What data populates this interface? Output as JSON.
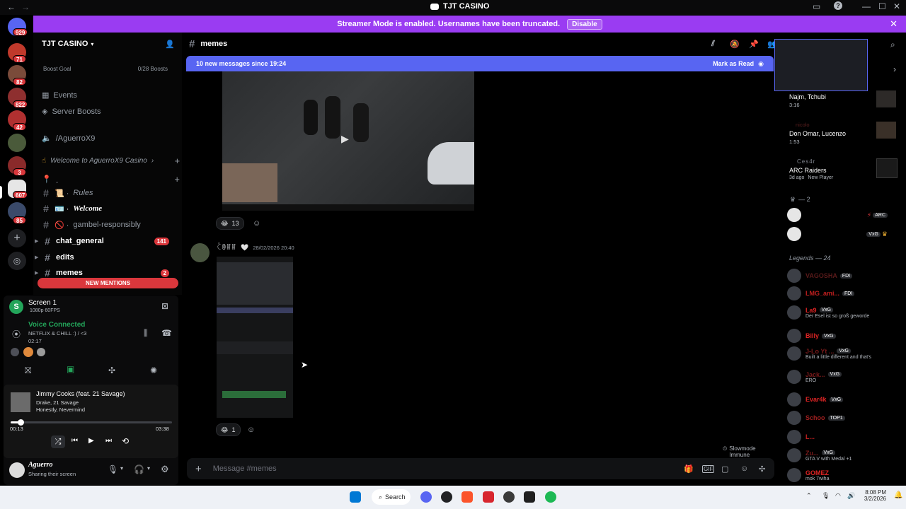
{
  "titlebar": {
    "back": "←",
    "forward": "→",
    "title": "TJT CASINO"
  },
  "banner": {
    "text": "Streamer Mode is enabled. Usernames have been truncated.",
    "disable": "Disable"
  },
  "rail": {
    "badges": [
      "929",
      "71",
      "82",
      "822",
      "42",
      "3",
      "607",
      "85"
    ]
  },
  "sidebar": {
    "server_name": "TJT CASINO",
    "boost_goal": "Boost Goal",
    "boost_count": "0/28 Boosts",
    "events": "Events",
    "server_boosts": "Server Boosts",
    "aguerro_channel": "/AguerroX9",
    "welcome_category": "Welcome to AguerroX9 Casino",
    "empty_category": "˯",
    "channels": [
      {
        "label": "Rules",
        "prefix": "📜 ·"
      },
      {
        "label": "Welcome",
        "prefix": "🪪 ·"
      },
      {
        "label": "gambel-responsibly",
        "prefix": "🚫 ·"
      },
      {
        "label": "chat_general",
        "count": "141"
      },
      {
        "label": "edits"
      },
      {
        "label": "memes",
        "count": "2"
      }
    ],
    "new_mentions": "NEW MENTIONS"
  },
  "panel": {
    "stream_title": "Screen 1",
    "stream_quality": "1080p 60FPS",
    "voice_status": "Voice Connected",
    "voice_channel": "NETFLIX & CHILL :) / <3",
    "voice_timer": "02:17",
    "song_title": "Jimmy Cooks (feat. 21 Savage)",
    "song_artist": "Drake, 21 Savage",
    "song_album": "Honestly, Nevermind",
    "time_elapsed": "00:13",
    "time_total": "03:38",
    "progress": 0.06,
    "username": "Aguerro",
    "user_status": "Sharing their screen"
  },
  "channel": {
    "name": "memes"
  },
  "new_bar": {
    "text": "10 new messages since 19:24",
    "mark": "Mark as Read"
  },
  "messages": {
    "reaction1_count": "13",
    "author": "ꉓꂦꂵꂵ",
    "timestamp": "28/02/2026 20:40",
    "reaction2_count": "1",
    "slowmode": "Slowmode Immune"
  },
  "composer": {
    "placeholder": "Message #memes"
  },
  "members": {
    "activity": [
      {
        "name": "Najm, Tchubi",
        "time": "3:16"
      },
      {
        "name": "Don Omar, Lucenzo",
        "time": "1:53",
        "user": "nicolo"
      },
      {
        "name": "ARC Raiders",
        "time": "3d ago",
        "extra": "New Player",
        "user": "Ces4r"
      }
    ],
    "group_count": "— 2",
    "arc_tag": "ARC",
    "vxg_tag": "VxG",
    "legends_header": "Legends — 24",
    "rows": [
      {
        "name": "VAGOSHA",
        "tag": "FDI"
      },
      {
        "name": "LMG_ami...",
        "tag": "FDI"
      },
      {
        "name": "La9",
        "tag": "VxG",
        "status": "Der Esel ist so groß geworde"
      },
      {
        "name": "Billy",
        "tag": "VxG"
      },
      {
        "name": "J-Lo Yt ...",
        "tag": "VxG",
        "status": "Built a little different and that's"
      },
      {
        "name": "Jack...",
        "tag": "VxG",
        "status": "ERO"
      },
      {
        "name": "Evar4k",
        "tag": "VxG"
      },
      {
        "name": "Schoo",
        "tag": "TOP1"
      },
      {
        "name": "L..."
      },
      {
        "name": "Zu...",
        "tag": "VxG",
        "status": "GTA V with Medal +1"
      },
      {
        "name": "GOMEZ",
        "status": "mok 7wiha"
      }
    ]
  },
  "taskbar": {
    "search": "Search",
    "time": "8:08 PM",
    "date": "3/2/2026"
  }
}
